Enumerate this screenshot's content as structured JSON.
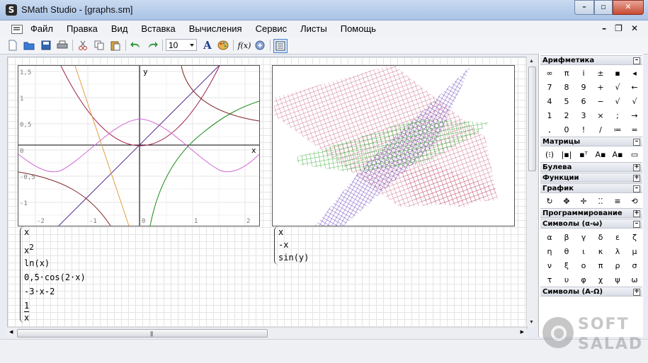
{
  "window": {
    "title": "SMath Studio - [graphs.sm]",
    "app_icon": "S",
    "min": "–",
    "max": "▫",
    "close": "✕"
  },
  "menu": {
    "items": [
      "Файл",
      "Правка",
      "Вид",
      "Вставка",
      "Вычисления",
      "Сервис",
      "Листы",
      "Помощь"
    ],
    "mdi": [
      "–",
      "❐",
      "✕"
    ]
  },
  "toolbar": {
    "font_size": "10",
    "fx_label": "f(x)",
    "text_tool": "A"
  },
  "plot2d": {
    "y_axis_label": "y",
    "x_axis_label": "x",
    "y_ticks": [
      "1,5",
      "1",
      "0,5",
      "0",
      "-0,5",
      "-1"
    ],
    "x_ticks": [
      "-2",
      "-1",
      "0",
      "1",
      "2"
    ],
    "colors": {
      "x": "#5a2d8e",
      "x2": "#8b1a3a",
      "ln": "#1a7a1a",
      "cos": "#d36ad6",
      "linear": "#e0a040",
      "recip": "#7a2020"
    },
    "functions": [
      "x",
      "x",
      "2",
      "ln",
      "x",
      "0,5·cos",
      "2·x",
      "-3·x-2",
      "1",
      "x"
    ]
  },
  "plot3d": {
    "functions": [
      "x",
      "-x",
      "sin",
      "y"
    ],
    "colors": {
      "surf1": "#c05070",
      "surf2": "#5020b0",
      "surf3": "#20a020"
    }
  },
  "panel": {
    "sections": [
      {
        "title": "Арифметика",
        "toggle": "–"
      },
      {
        "title": "Матрицы",
        "toggle": "–"
      },
      {
        "title": "Булева",
        "toggle": "+"
      },
      {
        "title": "Функции",
        "toggle": "+"
      },
      {
        "title": "График",
        "toggle": "–"
      },
      {
        "title": "Программирование",
        "toggle": "+"
      },
      {
        "title": "Символы (α-ω)",
        "toggle": "–"
      },
      {
        "title": "Символы (А-Ω)",
        "toggle": "+"
      }
    ],
    "arith": [
      "∞",
      "π",
      "i",
      "±",
      "▪",
      "◂",
      "7",
      "8",
      "9",
      "+",
      "√",
      "←",
      "4",
      "5",
      "6",
      "−",
      "√",
      "√",
      "1",
      "2",
      "3",
      "×",
      ";",
      "→",
      ",",
      "0",
      "!",
      "/",
      "≔",
      "="
    ],
    "matrix": [
      "(⁝)",
      "|▪|",
      "▪ᵀ",
      "A▪",
      "A▪",
      "▭"
    ],
    "graph": [
      "↻",
      "✥",
      "✛",
      "⁚⁚",
      "≡",
      "⟲"
    ],
    "greek": [
      "α",
      "β",
      "γ",
      "δ",
      "ε",
      "ζ",
      "η",
      "θ",
      "ι",
      "κ",
      "λ",
      "μ",
      "ν",
      "ξ",
      "ο",
      "π",
      "ρ",
      "σ",
      "τ",
      "υ",
      "φ",
      "χ",
      "ψ",
      "ω"
    ]
  },
  "watermark": {
    "top": "SOFT",
    "bottom": "SALAD"
  }
}
